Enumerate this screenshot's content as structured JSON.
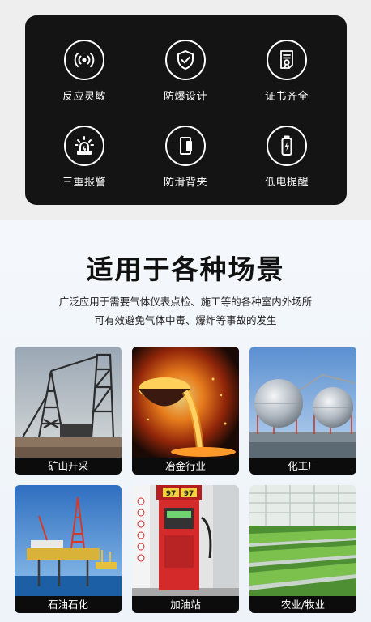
{
  "features": [
    {
      "label": "反应灵敏",
      "icon": "wireless-signal-icon"
    },
    {
      "label": "防爆设计",
      "icon": "shield-check-icon"
    },
    {
      "label": "证书齐全",
      "icon": "certificate-icon"
    },
    {
      "label": "三重报警",
      "icon": "alarm-light-icon"
    },
    {
      "label": "防滑背夹",
      "icon": "back-clip-icon"
    },
    {
      "label": "低电提醒",
      "icon": "low-battery-icon"
    }
  ],
  "scenes": {
    "title": "适用于各种场景",
    "desc_line1": "广泛应用于需要气体仪表点检、施工等的各种室内外场所",
    "desc_line2": "可有效避免气体中毒、爆炸等事故的发生",
    "cards": [
      {
        "label": "矿山开采"
      },
      {
        "label": "冶金行业"
      },
      {
        "label": "化工厂"
      },
      {
        "label": "石油石化"
      },
      {
        "label": "加油站",
        "price_1": "97",
        "price_2": "97"
      },
      {
        "label": "农业/牧业"
      }
    ]
  }
}
